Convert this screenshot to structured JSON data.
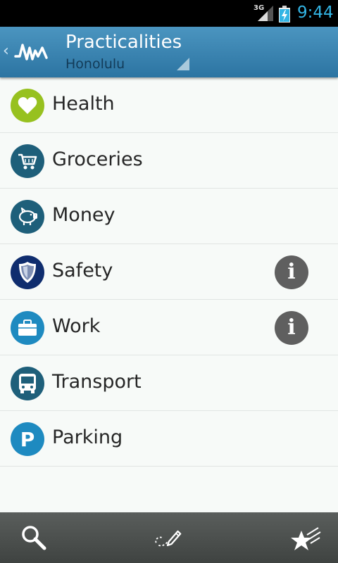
{
  "status_bar": {
    "network": "3G",
    "time": "9:44"
  },
  "header": {
    "title": "Practicalities",
    "subtitle": "Honolulu"
  },
  "items": [
    {
      "label": "Health",
      "icon": "heart-icon",
      "color": "#97c11f",
      "info": false
    },
    {
      "label": "Groceries",
      "icon": "shopping-cart-icon",
      "color": "#1e5f7a",
      "info": false
    },
    {
      "label": "Money",
      "icon": "piggy-bank-icon",
      "color": "#1e5f7a",
      "info": false
    },
    {
      "label": "Safety",
      "icon": "shield-icon",
      "color": "#0f2d6e",
      "info": true
    },
    {
      "label": "Work",
      "icon": "briefcase-icon",
      "color": "#1e8ac0",
      "info": true
    },
    {
      "label": "Transport",
      "icon": "bus-icon",
      "color": "#1e5f7a",
      "info": false
    },
    {
      "label": "Parking",
      "icon": "parking-icon",
      "color": "#1e8ac0",
      "info": false
    }
  ],
  "info_glyph": "i",
  "parking_glyph": "P",
  "bottom_bar": {
    "buttons": [
      "search-icon",
      "edit-icon",
      "favorites-icon"
    ]
  }
}
